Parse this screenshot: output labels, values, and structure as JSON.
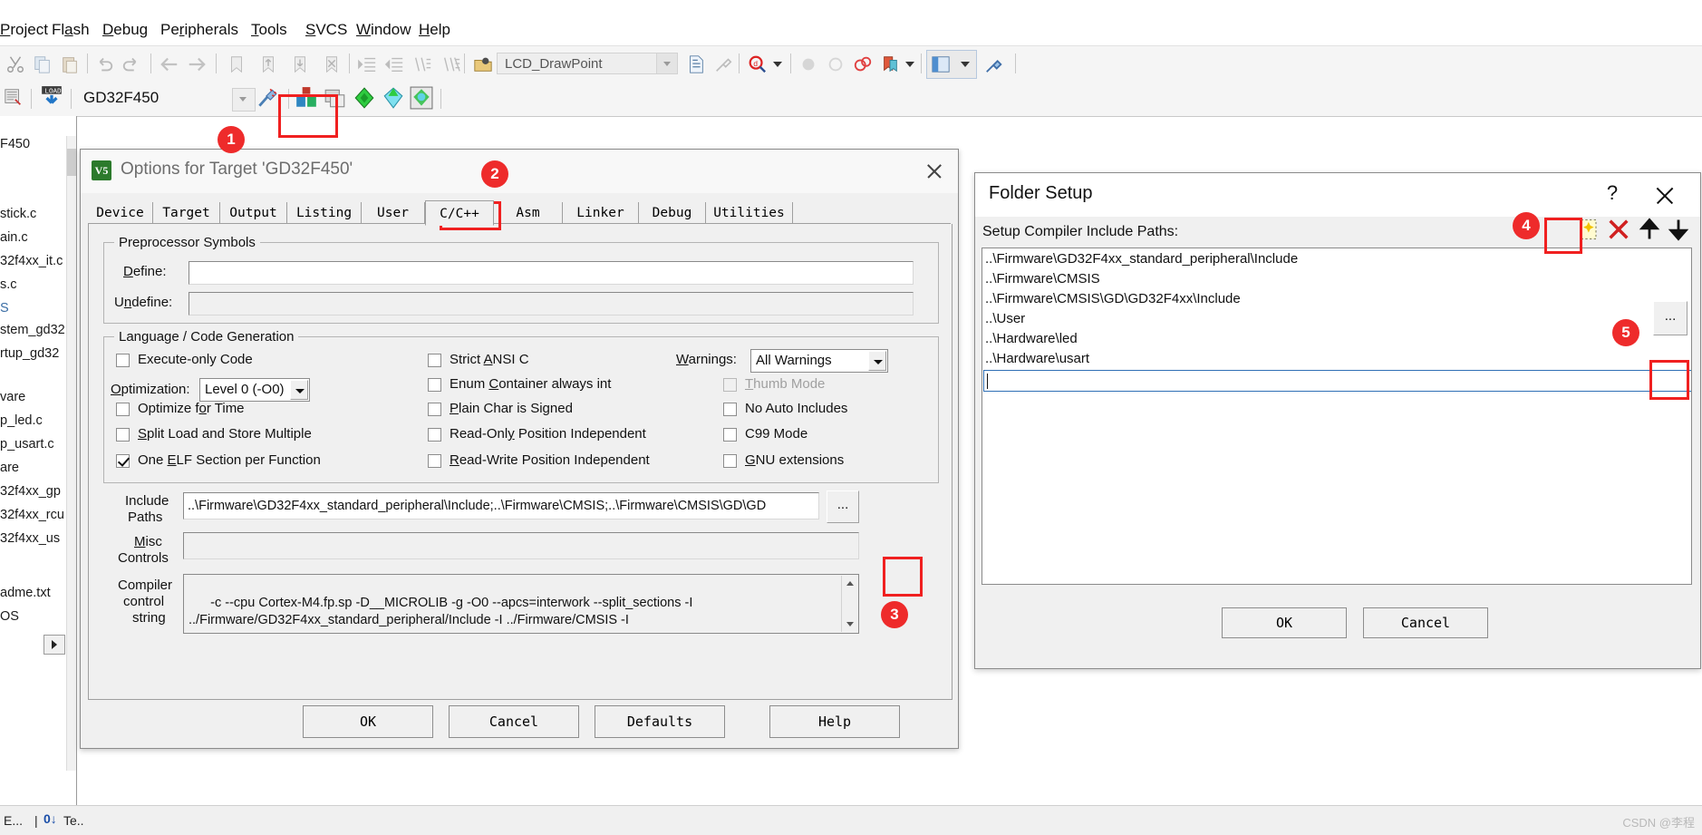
{
  "ide": {
    "menubar": [
      "Project",
      "Flash",
      "Debug",
      "Peripherals",
      "Tools",
      "SVCS",
      "Window",
      "Help"
    ],
    "menubar_mnemonics": [
      "P",
      "a",
      "D",
      "r",
      "T",
      "S",
      "W",
      "H"
    ],
    "toolbar1_icons": [
      "cut-icon",
      "copy-icon",
      "paste-icon",
      "undo-icon",
      "redo-icon",
      "navigate-back-icon",
      "navigate-forward-icon",
      "bookmark-toggle-icon",
      "bookmark-prev-icon",
      "bookmark-next-icon",
      "bookmark-clear-icon",
      "indent-icon",
      "outdent-icon",
      "comment-icon",
      "uncomment-icon"
    ],
    "function_combo_value": "LCD_DrawPoint",
    "toolbar1_right_icons": [
      "insert-file-icon",
      "configure-icon",
      "find-in-files-icon",
      "breakpoint-icon",
      "disable-breakpoint-icon",
      "kill-breakpoints-icon",
      "bookmarks-icon",
      "window-layout-icon",
      "configure-toolbars-icon"
    ],
    "target_combo_value": "GD32F450",
    "toolbar2_icons": [
      "batch-build-icon",
      "download-icon",
      "target-options-icon",
      "manage-runtime-icon",
      "multi-project-icon",
      "package-installer-icon",
      "pack-icon",
      "manage-components-icon"
    ],
    "project_pane": {
      "pin_icon": "pin-icon",
      "items": [
        "F450",
        "stick.c",
        "ain.c",
        "32f4xx_it.c",
        "s.c",
        "stem_gd32",
        "rtup_gd32",
        "vare",
        "p_led.c",
        "p_usart.c",
        "are",
        "32f4xx_gp",
        "32f4xx_rcu",
        "32f4xx_us",
        "adme.txt",
        "OS"
      ]
    },
    "status_left": "E...",
    "status_right": "Te..",
    "watermark": "CSDN @李程"
  },
  "options_dialog": {
    "title": "Options for Target 'GD32F450'",
    "window_icon": "keil-target-icon",
    "close_icon": "close-icon",
    "tabs": [
      "Device",
      "Target",
      "Output",
      "Listing",
      "User",
      "C/C++",
      "Asm",
      "Linker",
      "Debug",
      "Utilities"
    ],
    "selected_tab": "C/C++",
    "preprocessor": {
      "group_label": "Preprocessor Symbols",
      "define_label": "Define:",
      "define_value": "",
      "undefine_label": "Undefine:",
      "undefine_value": ""
    },
    "language": {
      "group_label": "Language / Code Generation",
      "col1": [
        {
          "label": "Execute-only Code",
          "checked": false,
          "disabled": false
        },
        {
          "label": "Optimize for Time",
          "checked": false,
          "disabled": false
        },
        {
          "label": "Split Load and Store Multiple",
          "checked": false,
          "disabled": false
        },
        {
          "label": "One ELF Section per Function",
          "checked": true,
          "disabled": false
        }
      ],
      "col2": [
        {
          "label": "Strict ANSI C",
          "checked": false,
          "disabled": false
        },
        {
          "label": "Enum Container always int",
          "checked": false,
          "disabled": false
        },
        {
          "label": "Plain Char is Signed",
          "checked": false,
          "disabled": false
        },
        {
          "label": "Read-Only Position Independent",
          "checked": false,
          "disabled": false
        },
        {
          "label": "Read-Write Position Independent",
          "checked": false,
          "disabled": false
        }
      ],
      "col3": [
        {
          "label": "Thumb Mode",
          "checked": false,
          "disabled": true
        },
        {
          "label": "No Auto Includes",
          "checked": false,
          "disabled": false
        },
        {
          "label": "C99 Mode",
          "checked": false,
          "disabled": false
        },
        {
          "label": "GNU extensions",
          "checked": false,
          "disabled": false
        }
      ],
      "optimization_label": "Optimization:",
      "optimization_value": "Level 0 (-O0)",
      "warnings_label": "Warnings:",
      "warnings_value": "All Warnings"
    },
    "include_paths_label_l1": "Include",
    "include_paths_label_l2": "Paths",
    "include_paths_value": "..\\Firmware\\GD32F4xx_standard_peripheral\\Include;..\\Firmware\\CMSIS;..\\Firmware\\CMSIS\\GD\\GD",
    "include_paths_browse": "...",
    "misc_controls_label_l1": "Misc",
    "misc_controls_label_l2": "Controls",
    "misc_controls_value": "",
    "compiler_string_label_l1": "Compiler",
    "compiler_string_label_l2": "control",
    "compiler_string_label_l3": "string",
    "compiler_string_value": "-c --cpu Cortex-M4.fp.sp -D__MICROLIB -g -O0 --apcs=interwork --split_sections -I\n../Firmware/GD32F4xx_standard_peripheral/Include -I ../Firmware/CMSIS -I",
    "buttons": {
      "ok": "OK",
      "cancel": "Cancel",
      "defaults": "Defaults",
      "help": "Help"
    }
  },
  "folder_setup": {
    "title": "Folder Setup",
    "help_icon": "question-mark-icon",
    "close_icon": "close-icon",
    "caption": "Setup Compiler Include Paths:",
    "toolbar": [
      {
        "name": "new-path-icon",
        "label": "New (Insert)"
      },
      {
        "name": "delete-path-icon",
        "label": "Delete"
      },
      {
        "name": "move-up-icon",
        "label": "Move Up"
      },
      {
        "name": "move-down-icon",
        "label": "Move Down"
      }
    ],
    "paths": [
      "..\\Firmware\\GD32F4xx_standard_peripheral\\Include",
      "..\\Firmware\\CMSIS",
      "..\\Firmware\\CMSIS\\GD\\GD32F4xx\\Include",
      "..\\User",
      "..\\Hardware\\led",
      "..\\Hardware\\usart"
    ],
    "edit_value": "",
    "edit_browse": "...",
    "ok": "OK",
    "cancel": "Cancel"
  },
  "annotations": [
    {
      "number": "1",
      "target": "toolbar-target-options-button"
    },
    {
      "number": "2",
      "target": "tab-c-cpp"
    },
    {
      "number": "3",
      "target": "include-paths-browse-button"
    },
    {
      "number": "4",
      "target": "folder-setup-new-path-button"
    },
    {
      "number": "5",
      "target": "folder-setup-edit-browse-button"
    }
  ],
  "accent": {
    "annotation_red": "#ee2b2b",
    "dialog_bg": "#f0f0f0",
    "selection_blue": "#2f6fb5"
  }
}
